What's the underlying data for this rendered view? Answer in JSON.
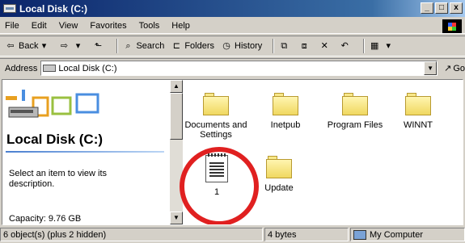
{
  "window": {
    "title": "Local Disk (C:)",
    "min_label": "_",
    "max_label": "□",
    "close_label": "x"
  },
  "menu": [
    "File",
    "Edit",
    "View",
    "Favorites",
    "Tools",
    "Help"
  ],
  "toolbar": {
    "back_label": "Back",
    "search_label": "Search",
    "folders_label": "Folders",
    "history_label": "History"
  },
  "address": {
    "label": "Address",
    "value": "Local Disk (C:)",
    "go_label": "Go"
  },
  "left_pane": {
    "title": "Local Disk (C:)",
    "description": "Select an item to view its description.",
    "capacity": "Capacity: 9.76 GB"
  },
  "files": [
    {
      "name": "Documents and Settings",
      "type": "folder"
    },
    {
      "name": "Inetpub",
      "type": "folder"
    },
    {
      "name": "Program Files",
      "type": "folder"
    },
    {
      "name": "WINNT",
      "type": "folder"
    },
    {
      "name": "1",
      "type": "file"
    },
    {
      "name": "Update",
      "type": "folder"
    }
  ],
  "status": {
    "objects": "6 object(s) (plus 2 hidden)",
    "size": "4 bytes",
    "zone": "My Computer"
  },
  "colors": {
    "highlight_circle": "#e02020",
    "titlebar": "#0a246a"
  }
}
